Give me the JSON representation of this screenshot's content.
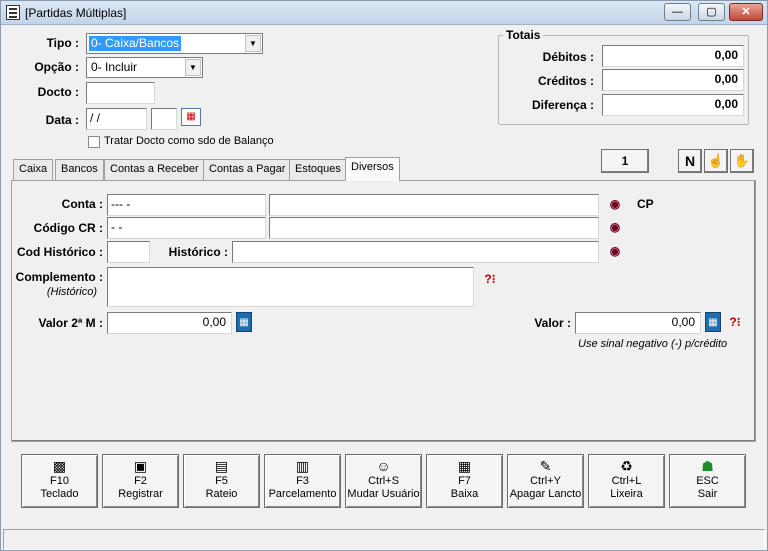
{
  "window": {
    "title": "[Partidas Múltiplas]",
    "minimize": "—",
    "maximize": "▢",
    "close": "✕"
  },
  "form": {
    "tipo_label": "Tipo :",
    "tipo_value": "0- Caixa/Bancos",
    "opcao_label": "Opção :",
    "opcao_value": "0- Incluir",
    "docto_label": "Docto :",
    "docto_value": "",
    "data_label": "Data :",
    "data_value": " / /",
    "data_extra": "",
    "checkbox_label": "Tratar Docto como sdo de Balanço"
  },
  "totais": {
    "title": "Totais",
    "debitos_label": "Débitos :",
    "debitos_value": "0,00",
    "creditos_label": "Créditos :",
    "creditos_value": "0,00",
    "diferenca_label": "Diferença :",
    "diferenca_value": "0,00"
  },
  "tabs": [
    "Caixa",
    "Bancos",
    "Contas a Receber",
    "Contas a Pagar",
    "Estoques",
    "Diversos"
  ],
  "active_tab": "Diversos",
  "counter": "1",
  "n_button": "N",
  "panel": {
    "conta_label": "Conta :",
    "conta_value": "--- -",
    "conta_desc": "",
    "cp_label": "CP",
    "codigo_cr_label": "Código CR :",
    "codigo_cr_value": "- -",
    "codigo_cr_desc": "",
    "cod_hist_label": "Cod Histórico :",
    "cod_hist_value": "",
    "historico_label": "Histórico :",
    "historico_value": "",
    "complemento_label": "Complemento :",
    "complemento_sub": "(Histórico)",
    "complemento_value": "",
    "valor2m_label": "Valor 2ª M :",
    "valor2m_value": "0,00",
    "valor_label": "Valor :",
    "valor_value": "0,00",
    "hint": "Use sinal negativo (-) p/crédito"
  },
  "toolbar": [
    {
      "key": "F10",
      "label": "Teclado",
      "icon": "keyboard-icon"
    },
    {
      "key": "F2",
      "label": "Registrar",
      "icon": "register-icon"
    },
    {
      "key": "F5",
      "label": "Rateio",
      "icon": "rateio-icon"
    },
    {
      "key": "F3",
      "label": "Parcelamento",
      "icon": "parcelamento-icon"
    },
    {
      "key": "Ctrl+S",
      "label": "Mudar Usuário",
      "icon": "user-switch-icon"
    },
    {
      "key": "F7",
      "label": "Baixa",
      "icon": "baixa-icon"
    },
    {
      "key": "Ctrl+Y",
      "label": "Apagar Lancto",
      "icon": "eraser-icon"
    },
    {
      "key": "Ctrl+L",
      "label": "Lixeira",
      "icon": "trash-icon"
    },
    {
      "key": "ESC",
      "label": "Sair",
      "icon": "exit-icon"
    }
  ],
  "colors": {
    "selection": "#3399ff",
    "calc_icon": "#1f6fb0",
    "exit_icon": "#1a8f2a"
  }
}
